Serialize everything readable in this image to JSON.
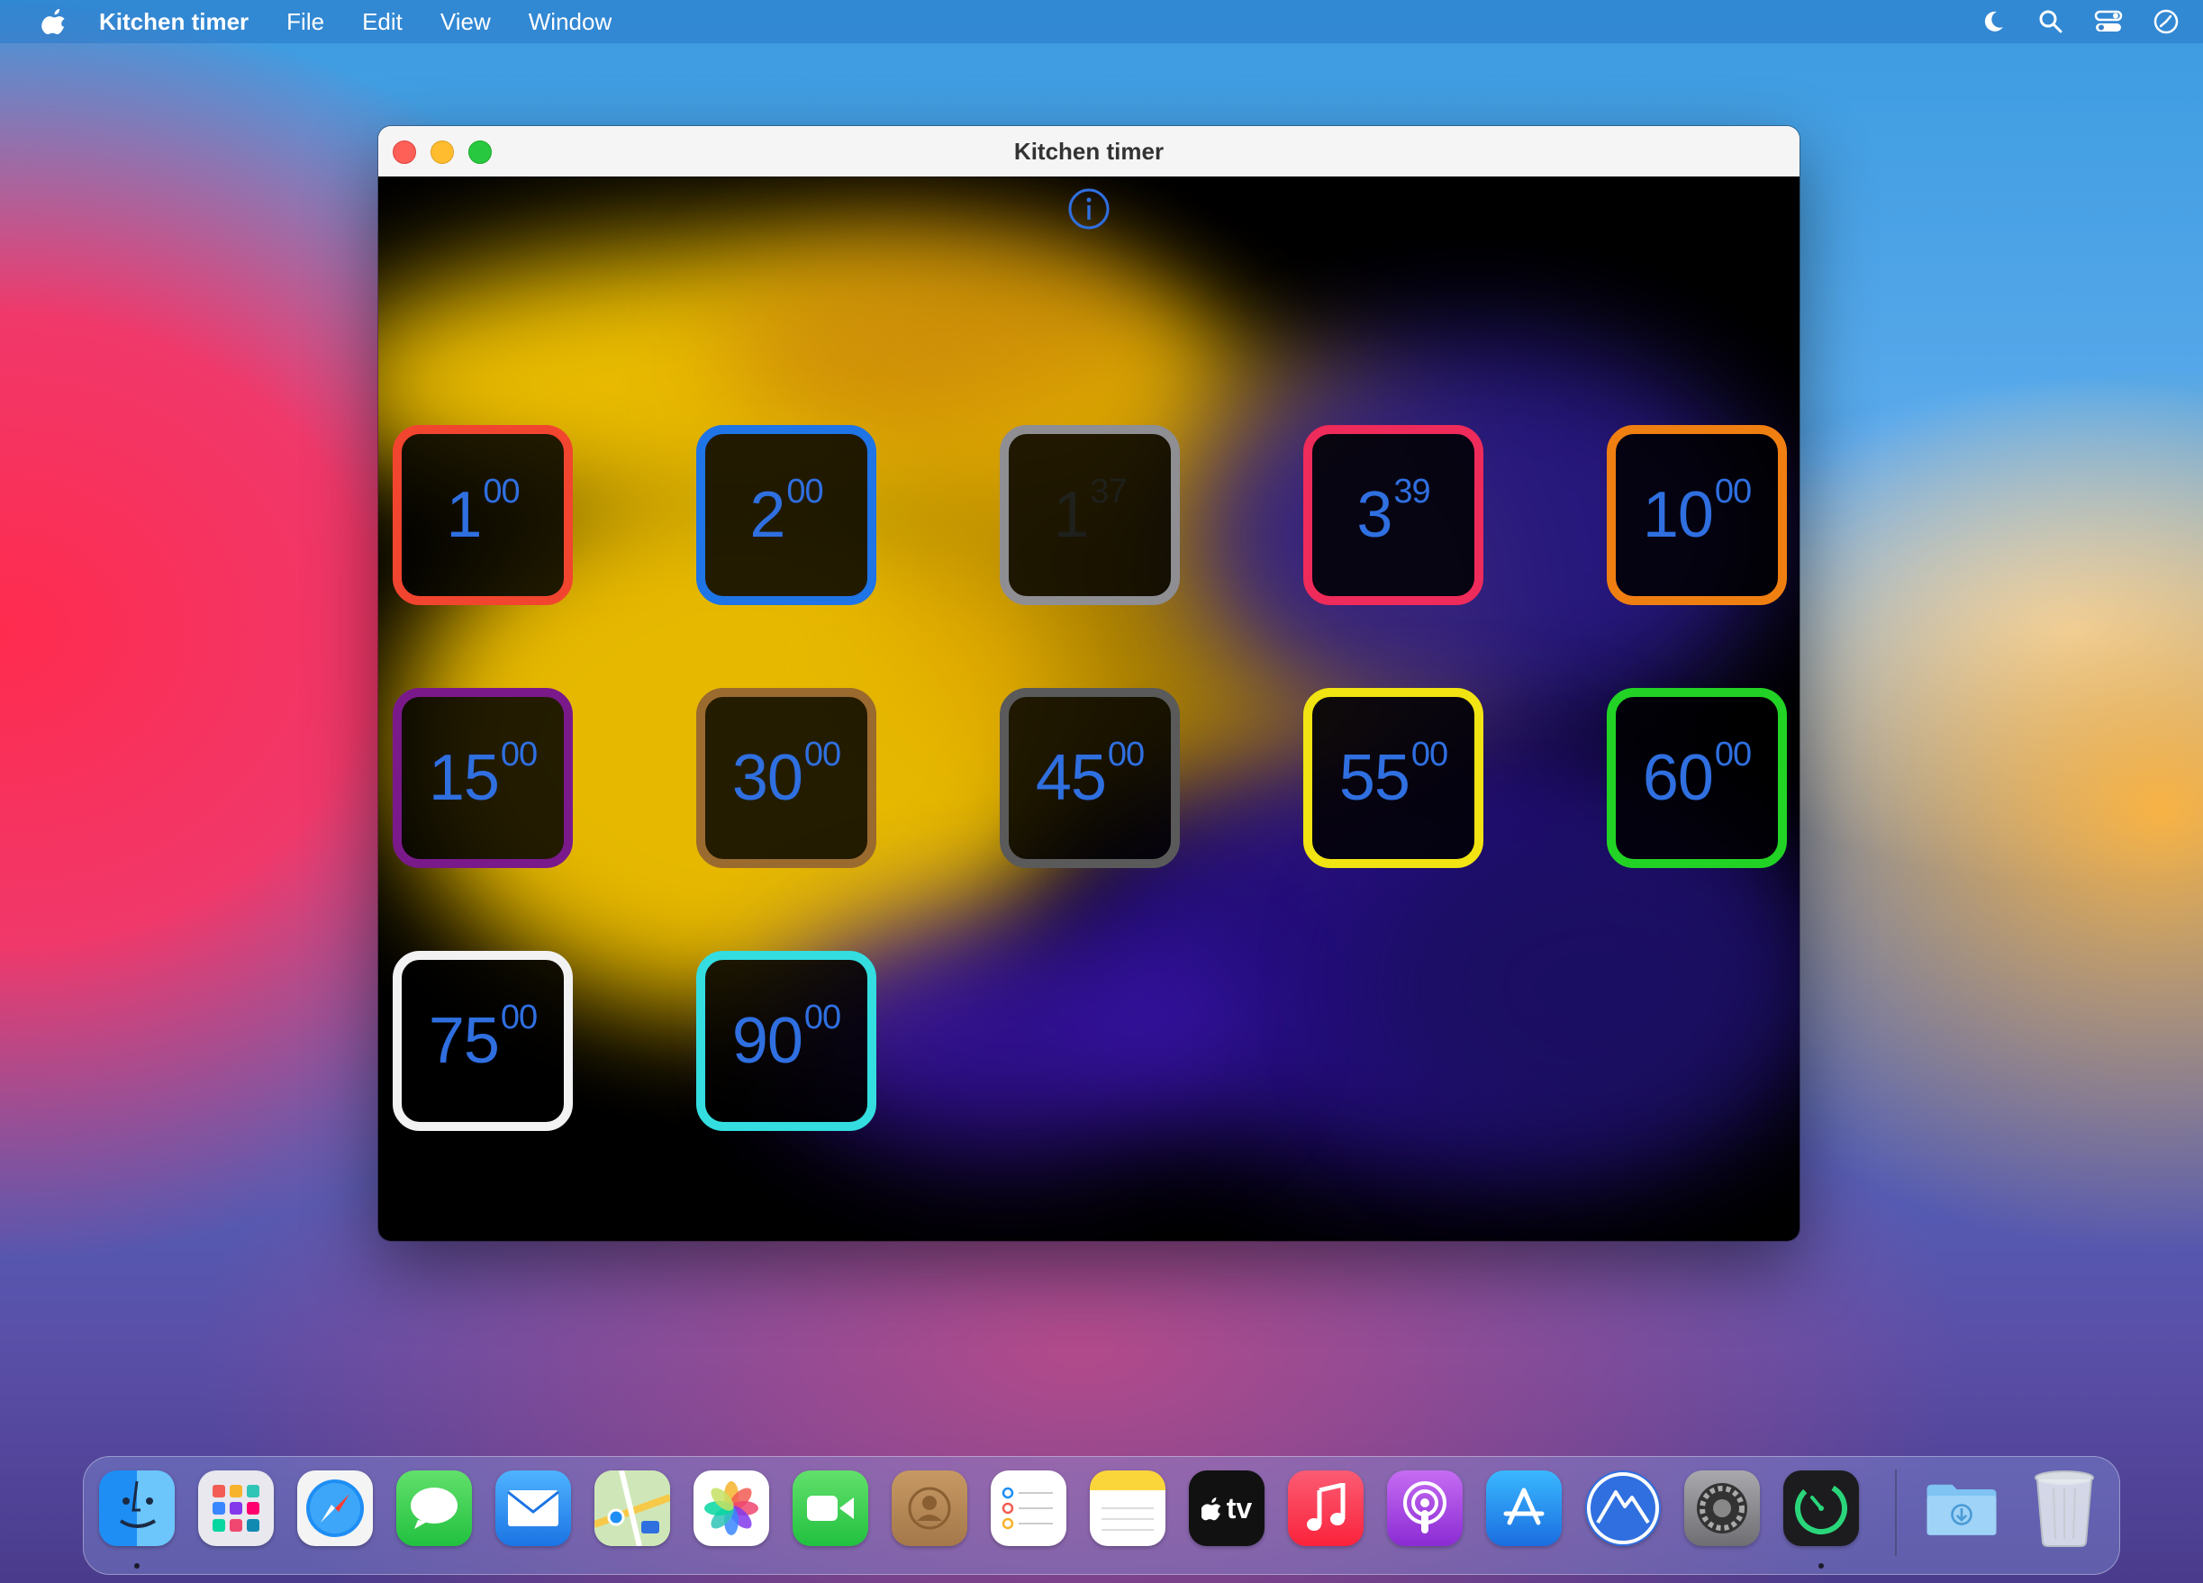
{
  "menubar": {
    "app_name": "Kitchen timer",
    "items": [
      "File",
      "Edit",
      "View",
      "Window"
    ]
  },
  "window": {
    "title": "Kitchen timer"
  },
  "timers": [
    {
      "min": "1",
      "sec": "00",
      "color": "#f2452f"
    },
    {
      "min": "2",
      "sec": "00",
      "color": "#1f74e6"
    },
    {
      "min": "1",
      "sec": "37",
      "color": "#8e8e93"
    },
    {
      "min": "3",
      "sec": "39",
      "color": "#ee2b5a"
    },
    {
      "min": "10",
      "sec": "00",
      "color": "#f07f12"
    },
    {
      "min": "15",
      "sec": "00",
      "color": "#7a1a8a"
    },
    {
      "min": "30",
      "sec": "00",
      "color": "#9a6a2e"
    },
    {
      "min": "45",
      "sec": "00",
      "color": "#5a5a5a"
    },
    {
      "min": "55",
      "sec": "00",
      "color": "#f2e312"
    },
    {
      "min": "60",
      "sec": "00",
      "color": "#22d325"
    },
    {
      "min": "75",
      "sec": "00",
      "color": "#f2f2f2"
    },
    {
      "min": "90",
      "sec": "00",
      "color": "#33dde0"
    }
  ],
  "colors": {
    "timer_text": "#2f6fe0"
  },
  "dock": {
    "icons": [
      "finder-icon",
      "launchpad-icon",
      "safari-icon",
      "messages-icon",
      "mail-icon",
      "maps-icon",
      "photos-icon",
      "facetime-icon",
      "contacts-icon",
      "reminders-icon",
      "notes-icon",
      "apple-tv-icon",
      "music-icon",
      "podcasts-icon",
      "app-store-icon",
      "altimeter-icon",
      "system-preferences-icon",
      "kitchen-timer-icon",
      "downloads-folder-icon",
      "trash-icon"
    ],
    "appletv_label": "tv"
  }
}
